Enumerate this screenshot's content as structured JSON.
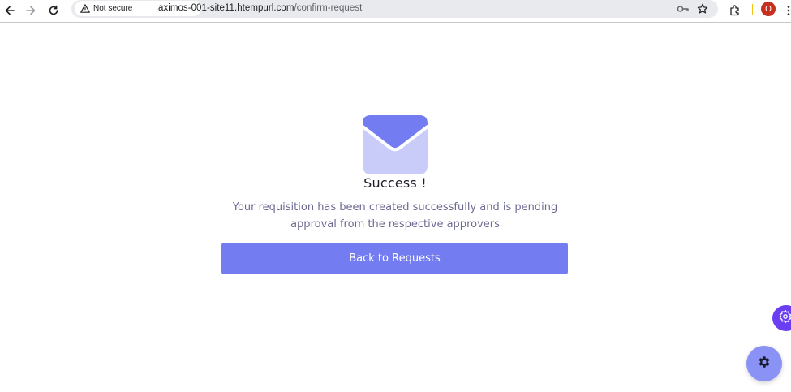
{
  "browser": {
    "security_label": "Not secure",
    "url_host": "aximos-001-site11.htempurl.com",
    "url_path": "/confirm-request",
    "profile_initial": "O",
    "icons": [
      "back-arrow-icon",
      "forward-arrow-icon",
      "reload-icon",
      "warning-icon",
      "password-key-icon",
      "bookmark-star-icon",
      "extensions-puzzle-icon",
      "more-menu-icon"
    ]
  },
  "main": {
    "title": "Success !",
    "message": "Your requisition has been created successfully and is pending approval from the respective approvers",
    "button_label": "Back to Requests",
    "icon": "envelope-icon"
  },
  "widgets": {
    "side_icon": "settings-sparkle-icon",
    "fab_icon": "gear-icon"
  },
  "colors": {
    "primary": "#737cf0",
    "envelope_flap": "#737cf0",
    "envelope_body": "#c9cbf9",
    "fab": "#8a92f5",
    "side_widget": "#6b3ef2",
    "message_text": "#6c6a91"
  }
}
